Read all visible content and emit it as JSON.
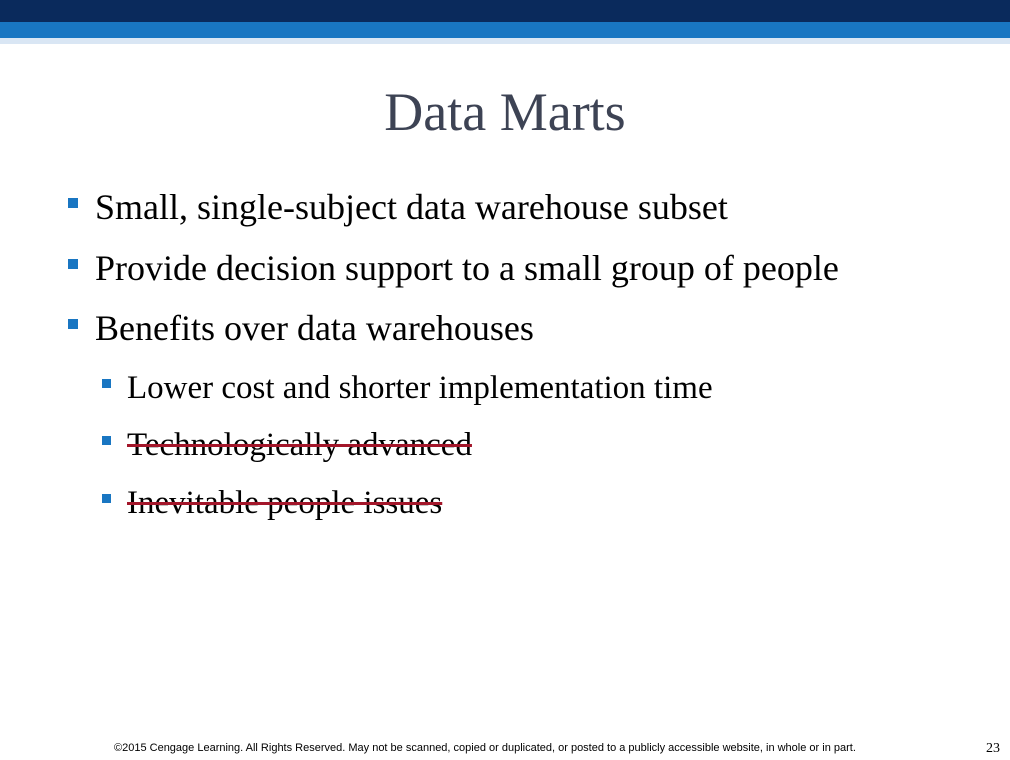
{
  "slide": {
    "title": "Data Marts",
    "bullets": [
      {
        "text": "Small, single-subject data warehouse subset"
      },
      {
        "text": "Provide decision support to a small group of people"
      },
      {
        "text": "Benefits over data warehouses"
      }
    ],
    "sub_bullets": [
      {
        "text": "Lower cost and shorter implementation time"
      },
      {
        "text": "Technologically advanced"
      },
      {
        "text": "Inevitable people issues"
      }
    ],
    "footer": "©2015 Cengage Learning. All Rights Reserved. May not be scanned, copied or duplicated, or posted to a publicly accessible website, in whole or in part.",
    "page_number": "23"
  },
  "colors": {
    "header_dark": "#0a2a5c",
    "header_accent": "#1976c2",
    "header_light": "#d9e6f4",
    "title": "#3d4354",
    "bullet": "#1976c2",
    "strike": "#a3162a"
  }
}
